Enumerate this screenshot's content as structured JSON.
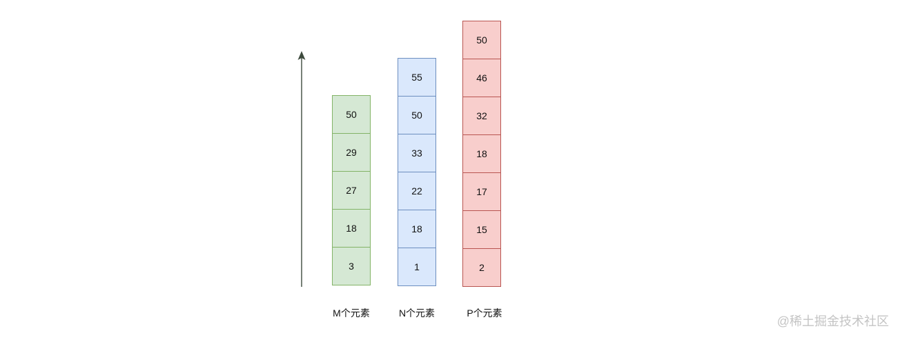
{
  "columns": [
    {
      "id": "m",
      "caption": "M个元素",
      "values": [
        "3",
        "18",
        "27",
        "29",
        "50"
      ],
      "fill": "#d5e8d4",
      "stroke": "#82b366"
    },
    {
      "id": "n",
      "caption": "N个元素",
      "values": [
        "1",
        "18",
        "22",
        "33",
        "50",
        "55"
      ],
      "fill": "#dae8fc",
      "stroke": "#6c8ebf"
    },
    {
      "id": "p",
      "caption": "P个元素",
      "values": [
        "2",
        "15",
        "17",
        "18",
        "32",
        "46",
        "50"
      ],
      "fill": "#f8cecc",
      "stroke": "#b85450"
    }
  ],
  "arrow_color": "#3d4a3d",
  "watermark": "@稀土掘金技术社区"
}
